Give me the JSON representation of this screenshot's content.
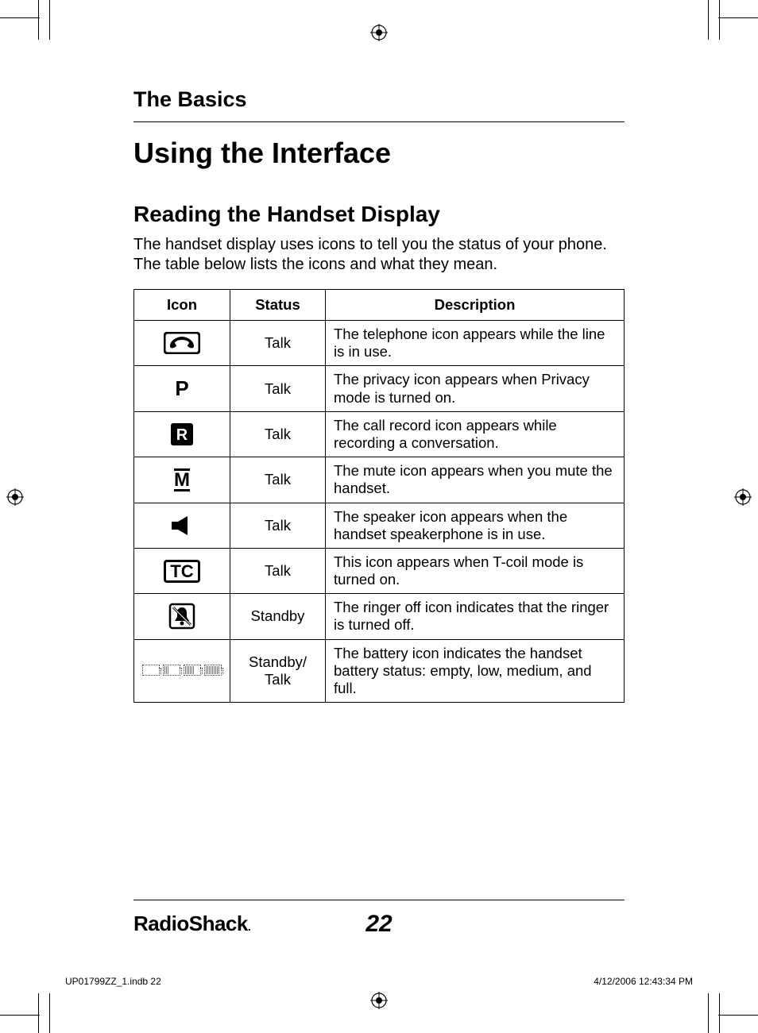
{
  "section_title": "The Basics",
  "heading1": "Using the Interface",
  "heading2": "Reading the Handset Display",
  "intro_paragraph": "The handset display uses icons to tell you the status of your phone. The table below lists the icons and what they mean.",
  "table": {
    "headers": {
      "icon": "Icon",
      "status": "Status",
      "description": "Description"
    },
    "rows": [
      {
        "icon_name": "telephone-icon",
        "status": "Talk",
        "description": "The telephone icon appears while the line is in use."
      },
      {
        "icon_name": "privacy-icon",
        "status": "Talk",
        "description": "The privacy icon appears when Privacy mode is turned on."
      },
      {
        "icon_name": "record-icon",
        "status": "Talk",
        "description": "The call record icon appears while recording a conversation."
      },
      {
        "icon_name": "mute-icon",
        "status": "Talk",
        "description": "The mute icon appears when you mute the handset."
      },
      {
        "icon_name": "speaker-icon",
        "status": "Talk",
        "description": "The speaker icon appears when the handset speakerphone is in use."
      },
      {
        "icon_name": "tcoil-icon",
        "status": "Talk",
        "description": "This icon appears when T-coil mode is turned on."
      },
      {
        "icon_name": "ringer-off-icon",
        "status": "Standby",
        "description": "The ringer off icon indicates that the ringer is turned off."
      },
      {
        "icon_name": "battery-icon",
        "status": "Standby/ Talk",
        "description": "The battery icon indicates the handset battery status: empty, low, medium, and full."
      }
    ]
  },
  "footer": {
    "brand": "RadioShack",
    "page_number": "22"
  },
  "slug": {
    "file": "UP01799ZZ_1.indb   22",
    "timestamp": "4/12/2006   12:43:34 PM"
  }
}
